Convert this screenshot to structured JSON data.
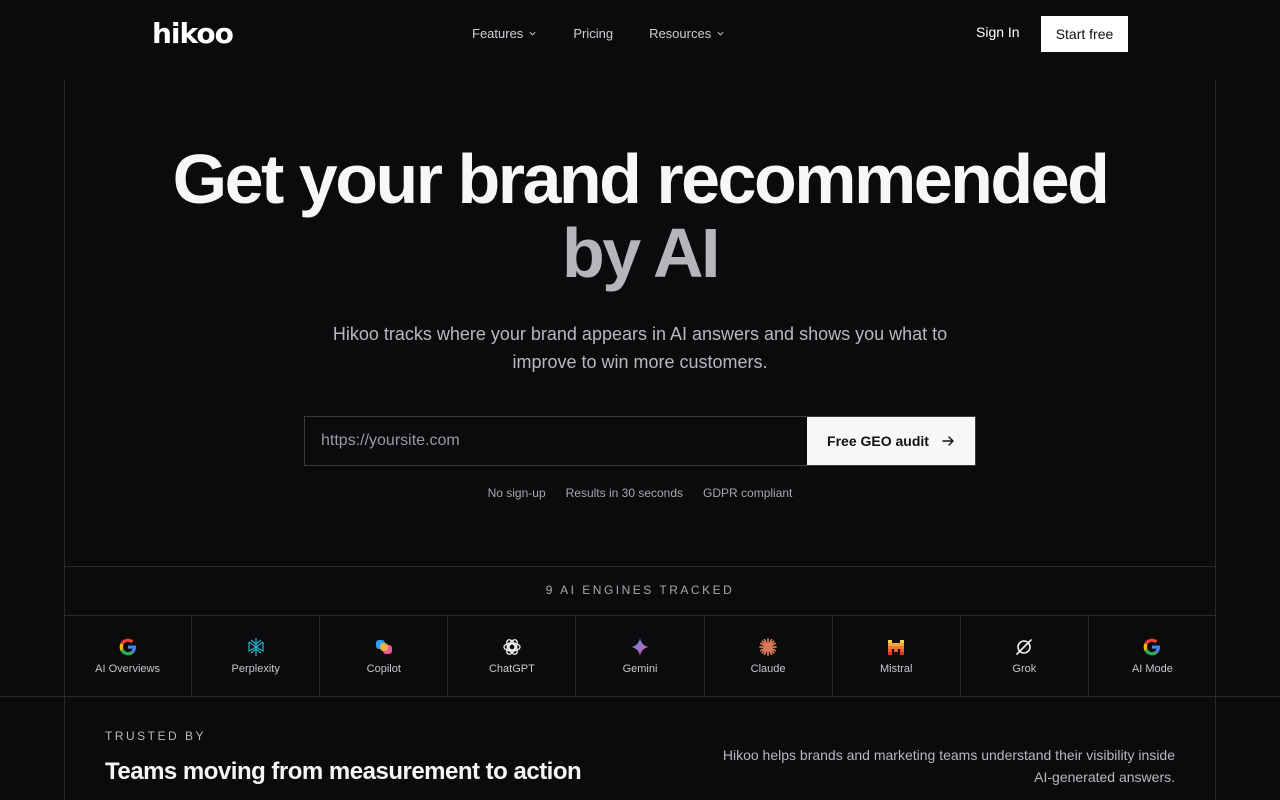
{
  "brand": {
    "logo": "hikoo"
  },
  "nav": {
    "items": [
      {
        "label": "Features",
        "dropdown": true
      },
      {
        "label": "Pricing",
        "dropdown": false
      },
      {
        "label": "Resources",
        "dropdown": true
      }
    ],
    "sign_in": "Sign In",
    "start_free": "Start free"
  },
  "hero": {
    "title_line1": "Get your brand recommended",
    "title_line2": "by AI",
    "subtitle": "Hikoo tracks where your brand appears in AI answers and shows you what to improve to win more customers.",
    "url_placeholder": "https://yoursite.com",
    "cta": "Free GEO audit",
    "badges": [
      "No sign-up",
      "Results in 30 seconds",
      "GDPR compliant"
    ]
  },
  "engines": {
    "label": "9 AI ENGINES TRACKED",
    "items": [
      {
        "name": "AI Overviews",
        "icon": "google-icon"
      },
      {
        "name": "Perplexity",
        "icon": "perplexity-icon"
      },
      {
        "name": "Copilot",
        "icon": "copilot-icon"
      },
      {
        "name": "ChatGPT",
        "icon": "chatgpt-icon"
      },
      {
        "name": "Gemini",
        "icon": "gemini-icon"
      },
      {
        "name": "Claude",
        "icon": "claude-icon"
      },
      {
        "name": "Mistral",
        "icon": "mistral-icon"
      },
      {
        "name": "Grok",
        "icon": "grok-icon"
      },
      {
        "name": "AI Mode",
        "icon": "google-icon"
      }
    ]
  },
  "trusted": {
    "label": "TRUSTED BY",
    "title": "Teams moving from measurement to action",
    "description": "Hikoo helps brands and marketing teams understand their visibility inside AI-generated answers."
  },
  "colors": {
    "background": "#0b0b0d",
    "accent_muted": "#b7b4bb",
    "button_bg": "#f7f7f7"
  }
}
